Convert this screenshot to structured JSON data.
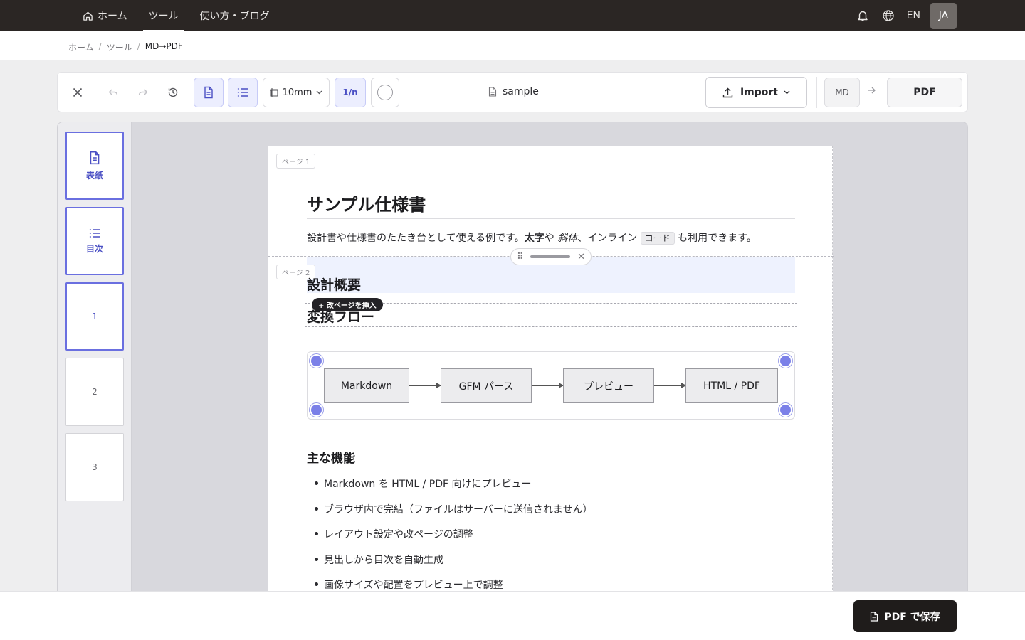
{
  "nav": {
    "home": "ホーム",
    "tools": "ツール",
    "guide": "使い方・ブログ",
    "lang": "EN",
    "avatar": "JA"
  },
  "breadcrumb": {
    "home": "ホーム",
    "tools": "ツール",
    "current": "MD→PDF"
  },
  "toolbar": {
    "margin_value": "10mm",
    "page_number": "1/n",
    "filename": "sample",
    "import_label": "Import",
    "source_format": "MD",
    "target_format": "PDF"
  },
  "sidebar": {
    "cover": "表紙",
    "toc": "目次",
    "pages": [
      "1",
      "2",
      "3"
    ]
  },
  "document": {
    "page1_tag": "ページ 1",
    "page2_tag": "ページ 2",
    "title": "サンプル仕様書",
    "intro": {
      "before": "設計書や仕様書のたたき台として使える例です。",
      "bold": "太字",
      "mid1": "や ",
      "italic": "斜体",
      "mid2": "、インライン ",
      "code": "コード",
      "after": " も利用できます。"
    },
    "section1": "設計概要",
    "section2": "変換フロー",
    "insert_break": "+ 改ページを挿入",
    "flow": [
      "Markdown",
      "GFM パース",
      "プレビュー",
      "HTML / PDF"
    ],
    "features_heading": "主な機能",
    "features": [
      "Markdown を HTML / PDF 向けにプレビュー",
      "ブラウザ内で完結（ファイルはサーバーに送信されません）",
      "レイアウト設定や改ページの調整",
      "見出しから目次を自動生成",
      "画像サイズや配置をプレビュー上で調整"
    ]
  },
  "footer": {
    "save_pdf": "PDF で保存"
  },
  "colors": {
    "nav_bg": "#2b2624",
    "accent": "#6a6fe0",
    "save_bg": "#1f1c1b"
  }
}
